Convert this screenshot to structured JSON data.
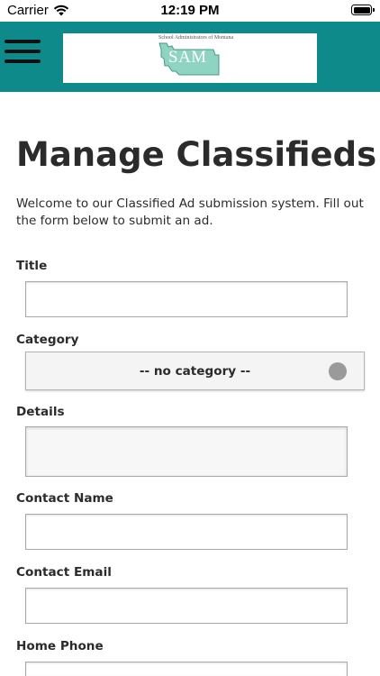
{
  "status_bar": {
    "carrier": "Carrier",
    "time": "12:19 PM"
  },
  "header": {
    "logo": {
      "caption": "School Administrators of Montana",
      "abbreviation": "SAM",
      "colors": {
        "map_fill": "#8fd3c2",
        "map_stroke": "#4a9a86"
      }
    },
    "colors": {
      "bar": "#0f8a8a",
      "menu_icon": "#111111"
    }
  },
  "page": {
    "title": "Manage Classifieds",
    "intro": "Welcome to our Classified Ad submission system. Fill out the form below to submit an ad."
  },
  "form": {
    "title_label": "Title",
    "title_value": "",
    "category_label": "Category",
    "category_selected": "-- no category --",
    "details_label": "Details",
    "details_value": "",
    "contact_name_label": "Contact Name",
    "contact_name_value": "",
    "contact_email_label": "Contact Email",
    "contact_email_value": "",
    "home_phone_label": "Home Phone",
    "home_phone_value": ""
  },
  "icons": {
    "menu": "hamburger-menu-icon",
    "wifi": "wifi-icon",
    "battery": "battery-icon"
  }
}
